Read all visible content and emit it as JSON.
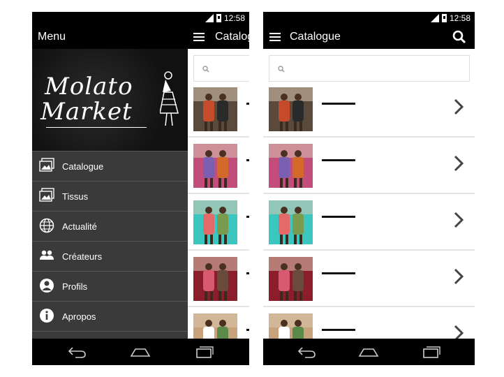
{
  "status": {
    "network": "3G",
    "time": "12:58"
  },
  "left_screen": {
    "drawer_title": "Menu",
    "app_title": "Catalogue",
    "logo_text_1": "Molato",
    "logo_text_2": "Market",
    "menu_items": [
      {
        "label": "Catalogue",
        "icon": "gallery-icon"
      },
      {
        "label": "Tissus",
        "icon": "gallery-icon"
      },
      {
        "label": "Actualité",
        "icon": "globe-icon"
      },
      {
        "label": "Créateurs",
        "icon": "people-icon"
      },
      {
        "label": "Profils",
        "icon": "person-icon"
      },
      {
        "label": "Apropos",
        "icon": "info-icon"
      }
    ]
  },
  "right_screen": {
    "app_title": "Catalogue",
    "search": {
      "placeholder": ""
    },
    "items": [
      {
        "thumb_colors": [
          "#5a4a3c",
          "#c64b2a",
          "#2a2a2a"
        ]
      },
      {
        "thumb_colors": [
          "#c24d7a",
          "#7b5fb0",
          "#d46a2a"
        ]
      },
      {
        "thumb_colors": [
          "#3cc6c0",
          "#e46a6a",
          "#7a9a50"
        ]
      },
      {
        "thumb_colors": [
          "#8b1e2a",
          "#d95a70",
          "#6a4a3a"
        ]
      },
      {
        "thumb_colors": [
          "#c7a27a",
          "#ffffff",
          "#5a8a4a"
        ]
      }
    ]
  },
  "colors": {
    "bar": "#000000",
    "drawer": "#3a3a3a",
    "divider": "#565656"
  }
}
